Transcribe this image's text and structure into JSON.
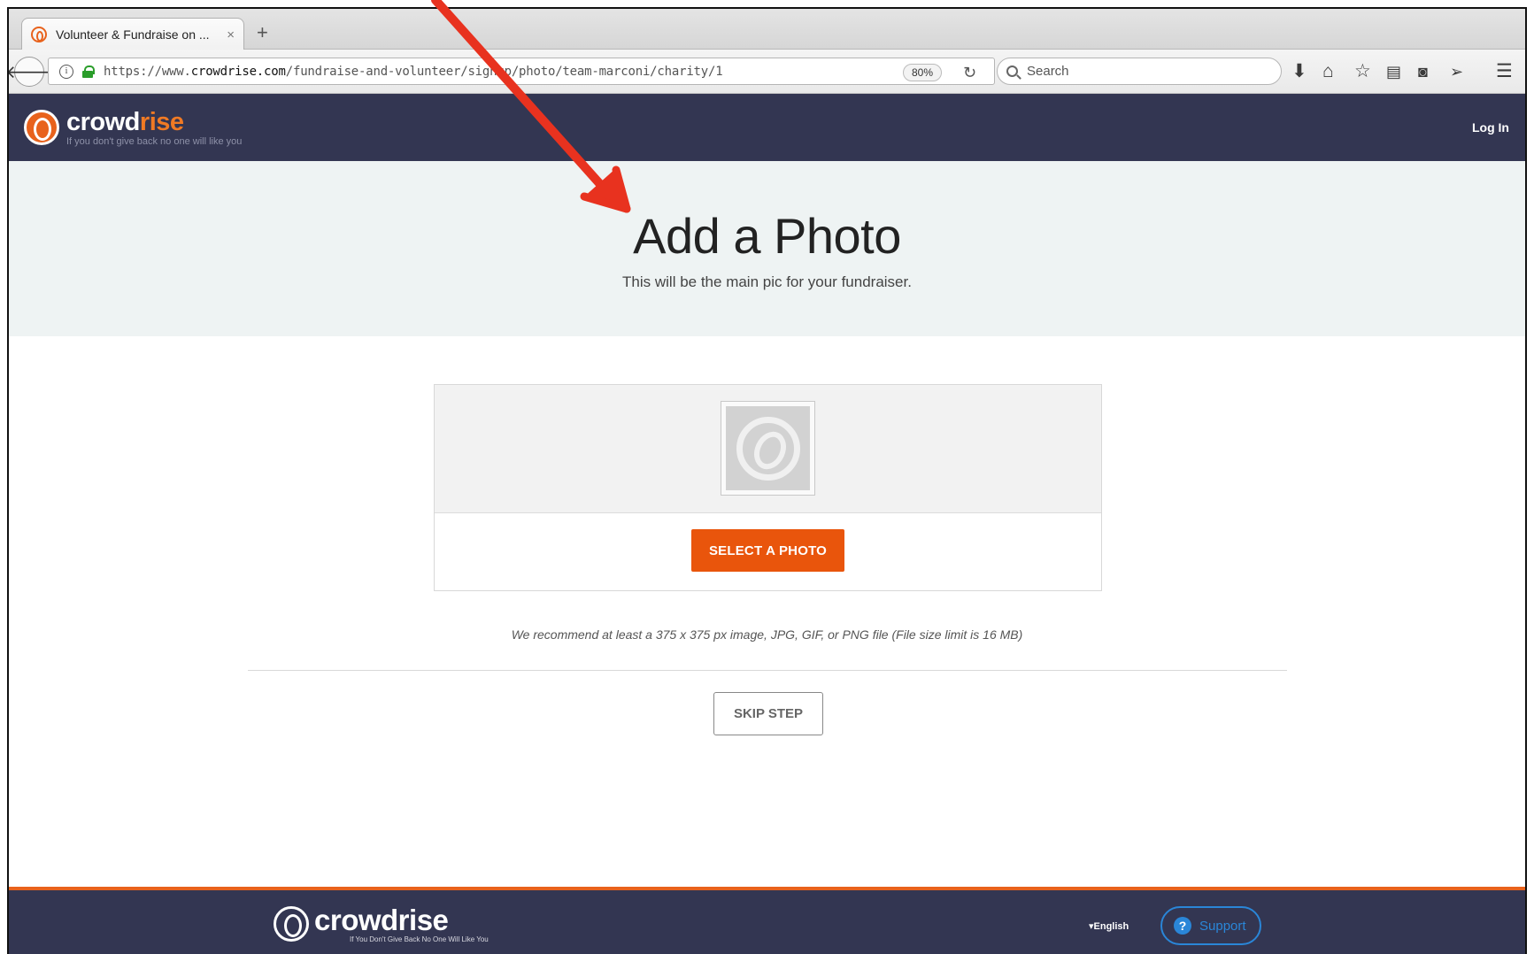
{
  "browser": {
    "tab_title": "Volunteer & Fundraise on ...",
    "tab_close": "×",
    "new_tab": "+",
    "url_prefix": "https://www.",
    "url_domain": "crowdrise.com",
    "url_path": "/fundraise-and-volunteer/signup/photo/team-marconi/charity/1",
    "zoom": "80%",
    "search_placeholder": "Search",
    "toolbar_icons": [
      "download-icon",
      "home-icon",
      "bookmark-star-icon",
      "reading-list-icon",
      "pocket-icon",
      "send-icon",
      "menu-icon"
    ]
  },
  "header": {
    "logo_word_a": "crowd",
    "logo_word_b": "rise",
    "tagline": "If you don't give back no one will like you",
    "login": "Log In"
  },
  "hero": {
    "title": "Add a Photo",
    "subtitle": "This will be the main pic for your fundraiser."
  },
  "upload": {
    "select_button": "SELECT A PHOTO",
    "recommendation": "We recommend at least a 375 x 375 px image, JPG, GIF, or PNG file (File size limit is 16 MB)",
    "skip_button": "SKIP STEP"
  },
  "footer": {
    "logo_word": "crowdrise",
    "tagline": "If You Don't Give Back No One Will Like You",
    "language": "English",
    "support": "Support"
  },
  "colors": {
    "nav_bg": "#333652",
    "accent_orange": "#e9550c",
    "hero_bg": "#eef3f3",
    "support_blue": "#2a86d8",
    "annotation_red": "#e8321f"
  }
}
